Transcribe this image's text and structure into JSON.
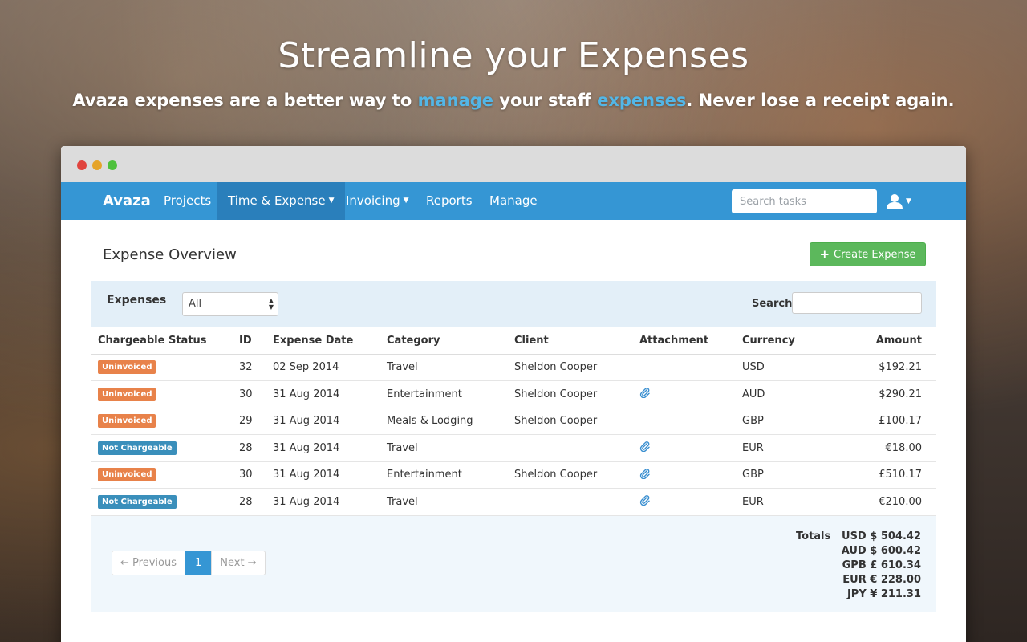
{
  "hero": {
    "title": "Streamline your Expenses",
    "sub_1": "Avaza expenses are a better way to ",
    "sub_2": "manage",
    "sub_3": " your staff ",
    "sub_4": "expenses",
    "sub_5": ". Never lose a receipt again."
  },
  "navbar": {
    "brand": "Avaza",
    "items": [
      {
        "label": "Projects"
      },
      {
        "label": "Time & Expense"
      },
      {
        "label": "Invoicing"
      },
      {
        "label": "Reports"
      },
      {
        "label": "Manage"
      }
    ],
    "search_placeholder": "Search tasks"
  },
  "page": {
    "title": "Expense Overview",
    "create_button": "Create Expense"
  },
  "filter": {
    "label": "Expenses",
    "select_value": "All",
    "search_label": "Search:"
  },
  "table": {
    "headers": [
      "Chargeable Status",
      "ID",
      "Expense Date",
      "Category",
      "Client",
      "Attachment",
      "Currency",
      "Amount"
    ],
    "rows": [
      {
        "status": "Uninvoiced",
        "id": "32",
        "date": "02 Sep 2014",
        "category": "Travel",
        "client": "Sheldon Cooper",
        "attachment": false,
        "currency": "USD",
        "amount": "$192.21"
      },
      {
        "status": "Uninvoiced",
        "id": "30",
        "date": "31 Aug 2014",
        "category": "Entertainment",
        "client": "Sheldon Cooper",
        "attachment": true,
        "currency": "AUD",
        "amount": "$290.21"
      },
      {
        "status": "Uninvoiced",
        "id": "29",
        "date": "31 Aug 2014",
        "category": "Meals & Lodging",
        "client": "Sheldon Cooper",
        "attachment": false,
        "currency": "GBP",
        "amount": "£100.17"
      },
      {
        "status": "Not Chargeable",
        "id": "28",
        "date": "31 Aug 2014",
        "category": "Travel",
        "client": "",
        "attachment": true,
        "currency": "EUR",
        "amount": "€18.00"
      },
      {
        "status": "Uninvoiced",
        "id": "30",
        "date": "31 Aug 2014",
        "category": "Entertainment",
        "client": "Sheldon Cooper",
        "attachment": true,
        "currency": "GBP",
        "amount": "£510.17"
      },
      {
        "status": "Not Chargeable",
        "id": "28",
        "date": "31 Aug 2014",
        "category": "Travel",
        "client": "",
        "attachment": true,
        "currency": "EUR",
        "amount": "€210.00"
      }
    ]
  },
  "pagination": {
    "prev": "← Previous",
    "current": "1",
    "next": "Next →"
  },
  "totals": {
    "label": "Totals",
    "lines": [
      "USD $ 504.42",
      "AUD $ 600.42",
      "GPB £ 610.34",
      "EUR € 228.00",
      "JPY ¥ 211.31"
    ]
  },
  "icons": {
    "attachment": "paperclip-icon",
    "user": "user-icon"
  },
  "colors": {
    "navbar": "#3596d4",
    "navbar_active": "#2a7fbb",
    "create_button": "#5cb85c",
    "badge_uninvoiced": "#e8824a",
    "badge_not_chargeable": "#3a8fbb",
    "highlight": "#53b6e6"
  }
}
